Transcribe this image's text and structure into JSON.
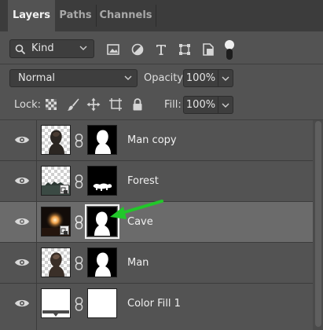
{
  "tabs": [
    {
      "label": "Layers",
      "active": true
    },
    {
      "label": "Paths",
      "active": false
    },
    {
      "label": "Channels",
      "active": false
    }
  ],
  "filter": {
    "kind_label": "Kind",
    "icons": [
      "image-filter-icon",
      "adjustment-filter-icon",
      "type-filter-icon",
      "shape-filter-icon",
      "smart-object-filter-icon",
      "filter-toggle"
    ]
  },
  "blend": {
    "mode": "Normal",
    "opacity_label": "Opacity:",
    "opacity_value": "100%"
  },
  "lock": {
    "label": "Lock:",
    "icons": [
      "lock-transparent-pixels-icon",
      "lock-image-pixels-icon",
      "lock-position-icon",
      "lock-artboard-icon",
      "lock-all-icon"
    ],
    "fill_label": "Fill:",
    "fill_value": "100%"
  },
  "layers": [
    {
      "name": "Man copy",
      "visible": true,
      "selected": false,
      "thumb": "man-photo",
      "mask": "silhouette-mask",
      "linked": true
    },
    {
      "name": "Forest",
      "visible": true,
      "selected": false,
      "thumb": "forest-smart-object",
      "mask": "bottom-shape-mask",
      "linked": true
    },
    {
      "name": "Cave",
      "visible": true,
      "selected": true,
      "thumb": "cave-smart-object",
      "mask": "silhouette-mask",
      "linked": true
    },
    {
      "name": "Man",
      "visible": true,
      "selected": false,
      "thumb": "man-photo",
      "mask": "silhouette-mask",
      "linked": true
    },
    {
      "name": "Color Fill 1",
      "visible": true,
      "selected": false,
      "thumb": "color-fill",
      "mask": "white-mask",
      "linked": true
    }
  ],
  "annotation": {
    "type": "arrow",
    "color": "#22c72a",
    "points_to": "Cave layer mask"
  },
  "colors": {
    "panel": "#535353",
    "tabbar": "#3c3c3c",
    "selected_row": "#6b6b6b",
    "arrow": "#22c72a"
  }
}
